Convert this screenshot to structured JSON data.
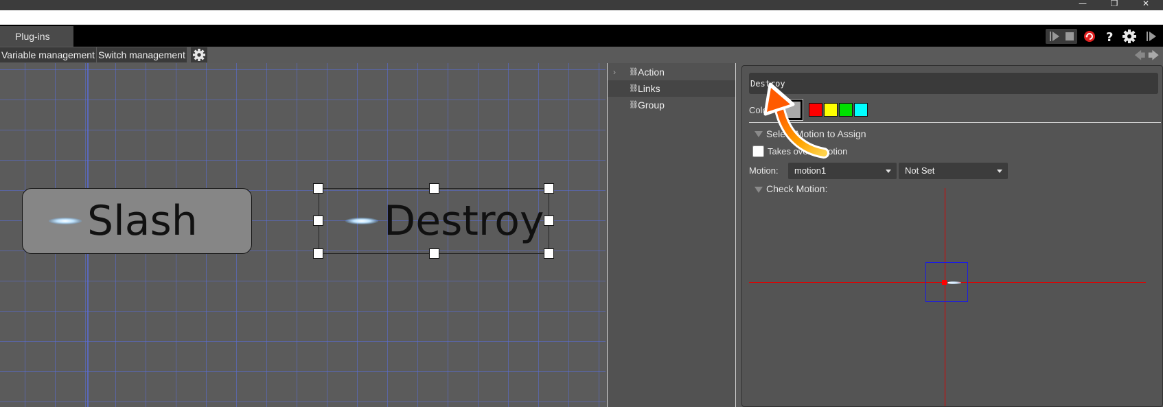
{
  "window": {
    "minimize_glyph": "—",
    "restore_glyph": "❐",
    "close_glyph": "✕"
  },
  "menubar": {
    "tab_label": "Plug-ins"
  },
  "subbar": {
    "variable_management": "Variable management",
    "switch_management": "Switch management"
  },
  "canvas": {
    "nodes": [
      {
        "label": "Slash"
      },
      {
        "label": "Destroy"
      }
    ]
  },
  "tree": {
    "items": [
      {
        "label": "Action"
      },
      {
        "label": "Links"
      },
      {
        "label": "Group"
      }
    ]
  },
  "props": {
    "name_value": "Destroy",
    "color_label": "Color:",
    "colors": [
      "#a8a8a8",
      "#ff0000",
      "#ffff00",
      "#00e000",
      "#00ffff"
    ],
    "select_motion_heading": "Select Motion to Assign",
    "takes_over_label": "Takes over a motion",
    "motion_label": "Motion:",
    "motion_value": "motion1",
    "second_value": "Not Set",
    "check_motion_heading": "Check Motion:"
  },
  "colors": {
    "accent_arrow": "#ff8c00",
    "crosshair": "#e00000",
    "bbox": "#1a1ae8"
  }
}
